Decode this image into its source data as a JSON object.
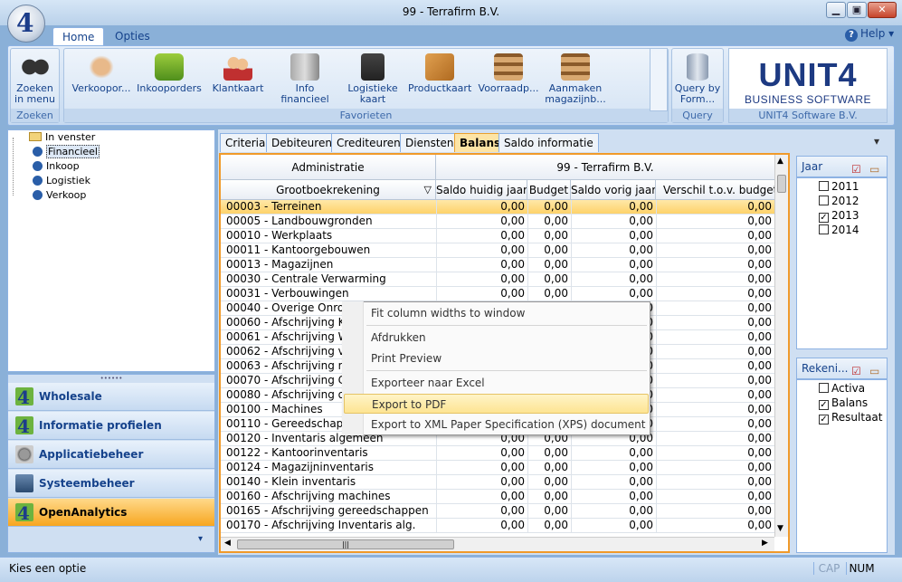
{
  "window": {
    "title": "99 - Terrafirm B.V."
  },
  "ribbon_tabs": [
    "Home",
    "Opties"
  ],
  "help_label": "Help",
  "groups": {
    "zoeken": {
      "caption": "Zoeken",
      "button": "Zoeken\nin menu"
    },
    "favorieten": {
      "caption": "Favorieten",
      "buttons": [
        "Verkoopor...",
        "Inkooporders",
        "Klantkaart",
        "Info\nfinancieel",
        "Logistieke\nkaart",
        "Productkaart",
        "Voorraadp...",
        "Aanmaken\nmagazijnb..."
      ]
    },
    "query": {
      "caption": "Query",
      "button": "Query by\nForm..."
    },
    "brand": {
      "name": "UNIT4",
      "subtitle": "BUSINESS SOFTWARE",
      "caption": "UNIT4 Software B.V."
    }
  },
  "tree": [
    "In venster",
    "Financieel",
    "Inkoop",
    "Logistiek",
    "Verkoop"
  ],
  "nav": [
    "Wholesale",
    "Informatie profielen",
    "Applicatiebeheer",
    "Systeembeheer",
    "OpenAnalytics"
  ],
  "content_tabs": [
    "Criteria",
    "Debiteuren",
    "Crediteuren",
    "Diensten",
    "Balans",
    "Saldo informatie"
  ],
  "grid": {
    "head_admin": "Administratie",
    "head_company": "99 - Terrafirm B.V.",
    "columns": [
      "Grootboekrekening",
      "Saldo huidig jaar",
      "Budget",
      "Saldo vorig jaar",
      "Verschil t.o.v. budget %"
    ],
    "rows": [
      {
        "name": "00003 - Terreinen",
        "v": [
          "0,00",
          "0,00",
          "0,00",
          "0,00"
        ]
      },
      {
        "name": "00005 - Landbouwgronden",
        "v": [
          "0,00",
          "0,00",
          "0,00",
          "0,00"
        ]
      },
      {
        "name": "00010 - Werkplaats",
        "v": [
          "0,00",
          "0,00",
          "0,00",
          "0,00"
        ]
      },
      {
        "name": "00011 - Kantoorgebouwen",
        "v": [
          "0,00",
          "0,00",
          "0,00",
          "0,00"
        ]
      },
      {
        "name": "00013 - Magazijnen",
        "v": [
          "0,00",
          "0,00",
          "0,00",
          "0,00"
        ]
      },
      {
        "name": "00030 - Centrale Verwarming",
        "v": [
          "0,00",
          "0,00",
          "0,00",
          "0,00"
        ]
      },
      {
        "name": "00031 - Verbouwingen",
        "v": [
          "0,00",
          "0,00",
          "0,00",
          "0,00"
        ]
      },
      {
        "name": "00040 - Overige Onroerende",
        "v": [
          "0,00",
          "0,00",
          "0,00",
          "0,00"
        ]
      },
      {
        "name": "00060 - Afschrijving Kantoor",
        "v": [
          "0,00",
          "0,00",
          "0,00",
          "0,00"
        ]
      },
      {
        "name": "00061 - Afschrijving Werkplaats",
        "v": [
          "0,00",
          "0,00",
          "0,00",
          "0,00"
        ]
      },
      {
        "name": "00062 - Afschrijving verbouwingen",
        "v": [
          "0,00",
          "0,00",
          "0,00",
          "0,00"
        ]
      },
      {
        "name": "00063 - Afschrijving magazijnen",
        "v": [
          "0,00",
          "0,00",
          "0,00",
          "0,00"
        ]
      },
      {
        "name": "00070 - Afschrijving CV",
        "v": [
          "0,00",
          "0,00",
          "0,00",
          "0,00"
        ]
      },
      {
        "name": "00080 - Afschrijving overige",
        "v": [
          "0,00",
          "0,00",
          "0,00",
          "0,00"
        ]
      },
      {
        "name": "00100 - Machines",
        "v": [
          "0,00",
          "0,00",
          "0,00",
          "0,00"
        ]
      },
      {
        "name": "00110 - Gereedschappen",
        "v": [
          "0,00",
          "0,00",
          "0,00",
          "0,00"
        ]
      },
      {
        "name": "00120 - Inventaris algemeen",
        "v": [
          "0,00",
          "0,00",
          "0,00",
          "0,00"
        ]
      },
      {
        "name": "00122 - Kantoorinventaris",
        "v": [
          "0,00",
          "0,00",
          "0,00",
          "0,00"
        ]
      },
      {
        "name": "00124 - Magazijninventaris",
        "v": [
          "0,00",
          "0,00",
          "0,00",
          "0,00"
        ]
      },
      {
        "name": "00140 - Klein inventaris",
        "v": [
          "0,00",
          "0,00",
          "0,00",
          "0,00"
        ]
      },
      {
        "name": "00160 - Afschrijving machines",
        "v": [
          "0,00",
          "0,00",
          "0,00",
          "0,00"
        ]
      },
      {
        "name": "00165 - Afschrijving gereedschappen",
        "v": [
          "0,00",
          "0,00",
          "0,00",
          "0,00"
        ]
      },
      {
        "name": "00170 - Afschrijving Inventaris alg.",
        "v": [
          "0,00",
          "0,00",
          "0,00",
          "0,00"
        ]
      }
    ]
  },
  "context_menu": [
    "Fit column widths to window",
    "Afdrukken",
    "Print Preview",
    "Exporteer naar Excel",
    "Export to PDF",
    "Export to XML Paper Specification (XPS) document"
  ],
  "panel_jaar": {
    "title": "Jaar",
    "items": [
      {
        "label": "2011",
        "checked": false
      },
      {
        "label": "2012",
        "checked": false
      },
      {
        "label": "2013",
        "checked": true
      },
      {
        "label": "2014",
        "checked": false
      }
    ]
  },
  "panel_rekening": {
    "title": "Rekeni...",
    "items": [
      {
        "label": "Activa",
        "checked": false
      },
      {
        "label": "Balans",
        "checked": true
      },
      {
        "label": "Resultaat",
        "checked": true
      }
    ]
  },
  "status": {
    "text": "Kies een optie",
    "cap": "CAP",
    "num": "NUM"
  }
}
